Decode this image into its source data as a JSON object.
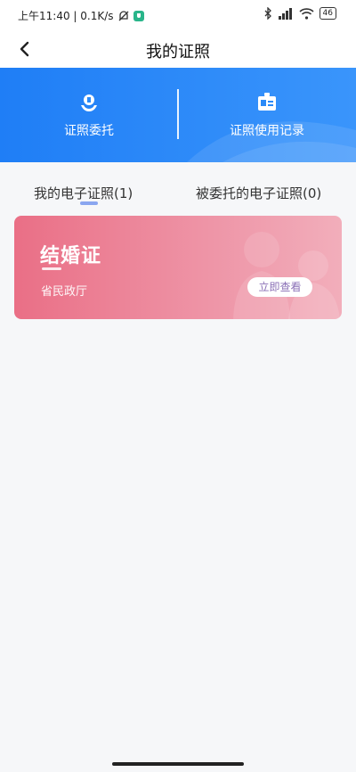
{
  "status_bar": {
    "time_speed": "上午11:40 | 0.1K/s",
    "battery": "46"
  },
  "header": {
    "title": "我的证照"
  },
  "banner": {
    "items": [
      {
        "label": "证照委托",
        "icon": "certificate-delegate-icon"
      },
      {
        "label": "证照使用记录",
        "icon": "id-card-record-icon"
      }
    ]
  },
  "tabs": [
    {
      "label": "我的电子证照(1)",
      "active": true
    },
    {
      "label": "被委托的电子证照(0)",
      "active": false
    }
  ],
  "certificates": [
    {
      "name": "结婚证",
      "department": "省民政厅",
      "action": "立即查看"
    }
  ],
  "colors": {
    "banner_blue": "#2486f7",
    "card_pink": "#ea6f86",
    "tab_indicator": "#8aa6f0"
  }
}
